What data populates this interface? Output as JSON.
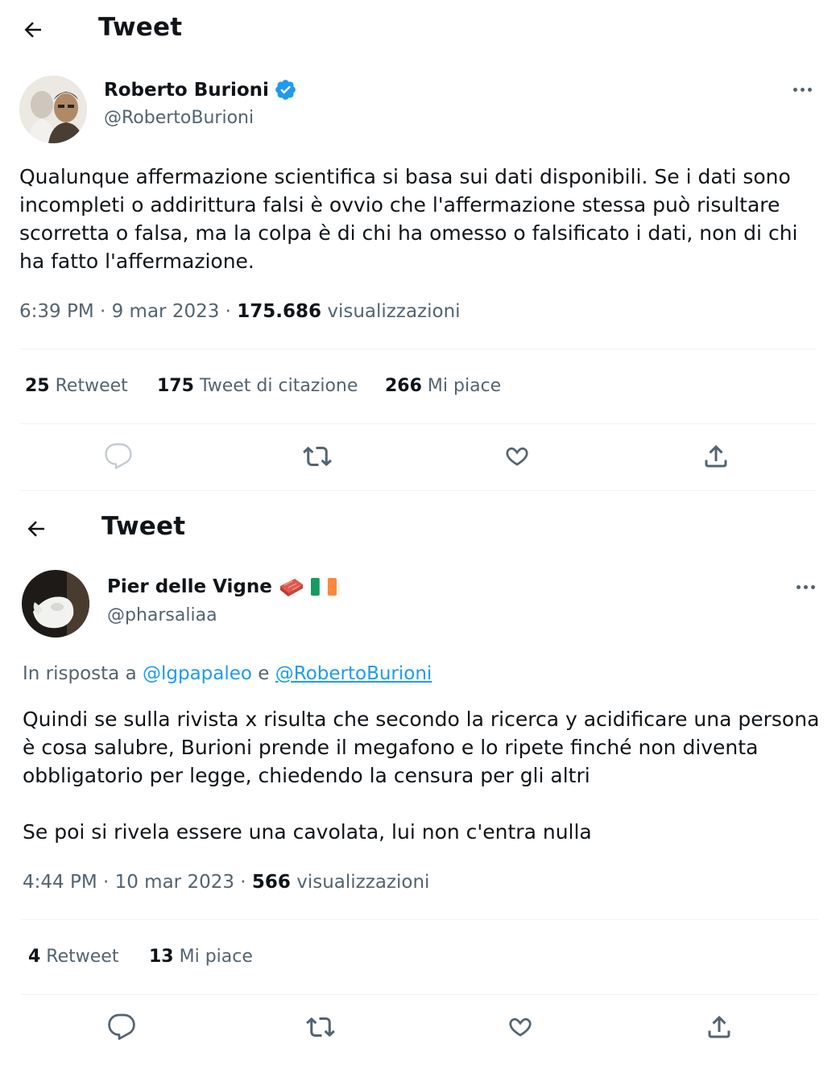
{
  "tweet1": {
    "header_title": "Tweet",
    "author": {
      "name": "Roberto Burioni",
      "handle": "@RobertoBurioni"
    },
    "text": "Qualunque affermazione scientifica si basa sui dati disponibili. Se i dati sono incompleti o addirittura falsi è ovvio che l'affermazione stessa può risultare scorretta o falsa, ma la colpa è di chi ha omesso o falsificato i dati, non di chi ha fatto l'affermazione.",
    "time": "6:39 PM · 9 mar 2023 · ",
    "views_count": "175.686",
    "views_label": " visualizzazioni",
    "stats": [
      {
        "count": "25",
        "label": " Retweet"
      },
      {
        "count": "175",
        "label": " Tweet di citazione"
      },
      {
        "count": "266",
        "label": " Mi piace"
      }
    ]
  },
  "tweet2": {
    "header_title": "Tweet",
    "author": {
      "name": "Pier delle Vigne",
      "handle": "@pharsaliaa"
    },
    "reply_prefix": "In risposta a ",
    "reply_user1": "@lgpapaleo",
    "reply_join": " e ",
    "reply_user2": "@RobertoBurioni",
    "text": "Quindi se sulla rivista x risulta che secondo la ricerca y acidificare una persona è cosa salubre, Burioni prende il megafono e lo ripete finché non diventa obbligatorio per legge, chiedendo la censura per gli altri\n\nSe poi si rivela essere una cavolata, lui non c'entra nulla",
    "time": "4:44 PM · 10 mar 2023 · ",
    "views_count": "566",
    "views_label": " visualizzazioni",
    "stats": [
      {
        "count": "4",
        "label": " Retweet"
      },
      {
        "count": "13",
        "label": " Mi piace"
      }
    ]
  },
  "colors": {
    "verified": "#1d9bf0",
    "link": "#1d9bf0",
    "secondary_text": "#536471",
    "divider": "#eff3f4"
  },
  "icons": [
    "back-arrow-icon",
    "verified-badge-icon",
    "more-icon",
    "reply-icon",
    "retweet-icon",
    "like-icon",
    "share-icon",
    "brick-emoji-icon",
    "irish-flag-icon"
  ]
}
